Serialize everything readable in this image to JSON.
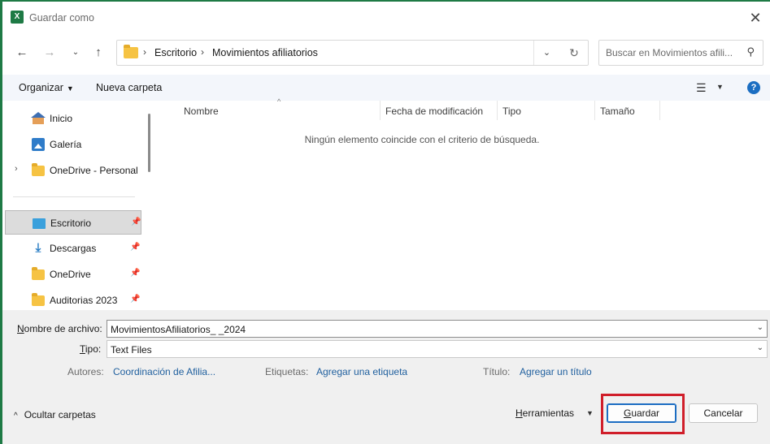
{
  "window": {
    "title": "Guardar como",
    "app_icon_letter": "X"
  },
  "address": {
    "crumbs": [
      "Escritorio",
      "Movimientos afiliatorios"
    ],
    "search_placeholder": "Buscar en Movimientos afili..."
  },
  "toolbar": {
    "organize_label": "Organizar",
    "new_folder_label": "Nueva carpeta",
    "help_label": "?"
  },
  "nav": {
    "items": [
      {
        "label": "Inicio",
        "icon": "home-icon"
      },
      {
        "label": "Galería",
        "icon": "gallery-icon"
      },
      {
        "label": "OneDrive - Personal",
        "icon": "folder-icon"
      },
      {
        "label": "Escritorio",
        "icon": "desktop-icon"
      },
      {
        "label": "Descargas",
        "icon": "download-icon"
      },
      {
        "label": "OneDrive",
        "icon": "folder-icon"
      },
      {
        "label": "Auditorias 2023",
        "icon": "folder-icon"
      }
    ]
  },
  "files": {
    "columns": [
      "Nombre",
      "Fecha de modificación",
      "Tipo",
      "Tamaño"
    ],
    "empty_message": "Ningún elemento coincide con el criterio de búsqueda."
  },
  "form": {
    "filename_label_u": "N",
    "filename_label_rest": "ombre de archivo:",
    "filename_value": "MovimientosAfiliatorios_                              _2024",
    "type_label_u": "T",
    "type_label_rest": "ipo:",
    "type_value": "Text Files",
    "authors_label": "Autores:",
    "authors_value": "Coordinación de Afilia...",
    "tags_label": "Etiquetas:",
    "tags_value": "Agregar una etiqueta",
    "title_label": "Título:",
    "title_value": "Agregar un título"
  },
  "footer": {
    "hide_folders_label": "Ocultar carpetas",
    "tools_u": "H",
    "tools_rest": "erramientas",
    "save_u": "G",
    "save_rest": "uardar",
    "cancel_label": "Cancelar"
  },
  "colors": {
    "accent": "#1e7a45",
    "link": "#1f5f9e",
    "highlight": "#d01e2a"
  }
}
